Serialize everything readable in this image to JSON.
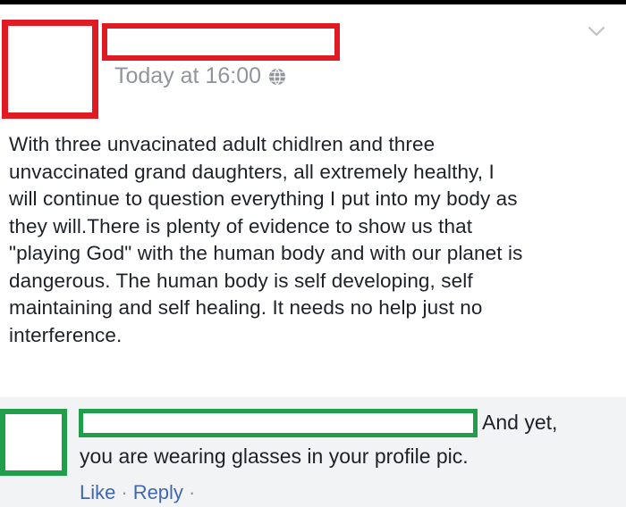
{
  "post": {
    "timestamp": "Today at 16:00",
    "privacy_icon": "globe-icon",
    "menu_icon": "chevron-down-icon",
    "lines": [
      "With three unvacinated adult chidlren and three",
      "unvaccinated grand daughters, all extremely healthy, I",
      "will continue to question everything I put into my body as",
      "they will.There is plenty of evidence to show us that",
      "\"playing God\" with the human body and with our planet is",
      "dangerous. The human body is self developing, self",
      "maintaining and self healing. It needs no help just no",
      "interference."
    ]
  },
  "comment": {
    "text_start": "And yet,",
    "text_rest": "you are wearing glasses in your profile pic.",
    "actions": {
      "like": "Like",
      "separator": "·",
      "reply": "Reply",
      "trailing_separator": "·"
    }
  },
  "colors": {
    "redaction_red": "#e11b23",
    "redaction_green": "#1f9e4c",
    "link_blue": "#4267b2",
    "meta_gray": "#90949c",
    "comment_bg": "#f2f3f5"
  }
}
